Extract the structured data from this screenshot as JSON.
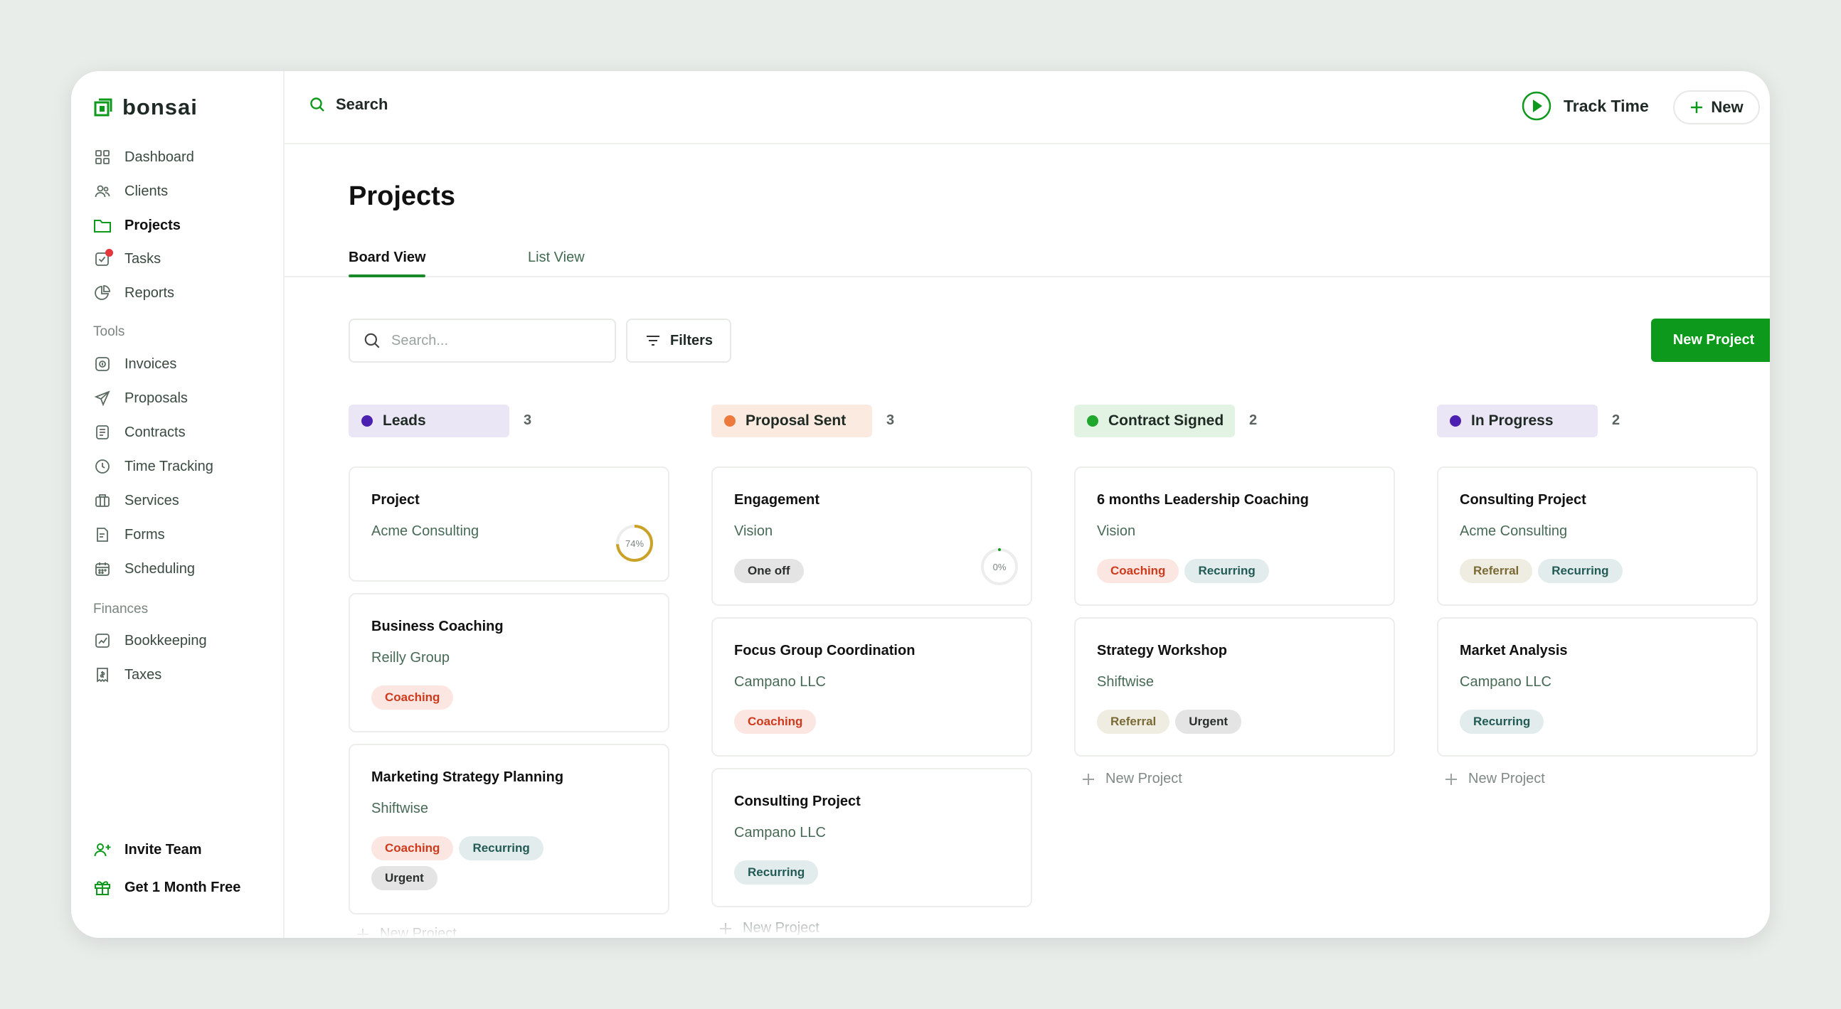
{
  "app": {
    "name": "bonsai"
  },
  "sidebar": {
    "items": [
      {
        "label": "Dashboard",
        "icon": "grid-icon"
      },
      {
        "label": "Clients",
        "icon": "users-icon"
      },
      {
        "label": "Projects",
        "icon": "folder-icon",
        "active": true
      },
      {
        "label": "Tasks",
        "icon": "task-check-icon",
        "badge": true
      },
      {
        "label": "Reports",
        "icon": "pie-chart-icon"
      }
    ],
    "tools_label": "Tools",
    "tools": [
      {
        "label": "Invoices",
        "icon": "invoice-icon"
      },
      {
        "label": "Proposals",
        "icon": "send-icon"
      },
      {
        "label": "Contracts",
        "icon": "document-icon"
      },
      {
        "label": "Time Tracking",
        "icon": "clock-icon"
      },
      {
        "label": "Services",
        "icon": "briefcase-icon"
      },
      {
        "label": "Forms",
        "icon": "form-icon"
      },
      {
        "label": "Scheduling",
        "icon": "calendar-icon"
      }
    ],
    "finances_label": "Finances",
    "finances": [
      {
        "label": "Bookkeeping",
        "icon": "chart-line-icon"
      },
      {
        "label": "Taxes",
        "icon": "tax-icon"
      }
    ],
    "invite_team": "Invite Team",
    "get_free": "Get 1 Month Free"
  },
  "topbar": {
    "search_label": "Search",
    "track_time": "Track Time",
    "new_label": "New"
  },
  "page": {
    "title": "Projects",
    "tabs": [
      {
        "label": "Board View",
        "active": true
      },
      {
        "label": "List View",
        "active": false
      }
    ],
    "search_placeholder": "Search...",
    "filters_label": "Filters",
    "new_project_label": "New Project",
    "add_project_label": "New Project"
  },
  "colors": {
    "accent": "#0d9a1c",
    "leads_dot": "#4b1fb0",
    "leads_bg": "#ebe6f6",
    "proposal_dot": "#ec7a3c",
    "proposal_bg": "#fbeae0",
    "contract_dot": "#1ea62d",
    "contract_bg": "#e2f3e3",
    "progress_dot": "#4b1fb0",
    "progress_bg": "#ebe6f6"
  },
  "columns": [
    {
      "name": "Leads",
      "count": "3",
      "cards": [
        {
          "title": "Project",
          "client": "Acme Consulting",
          "progress": "74%",
          "progress_value": 0.74
        },
        {
          "title": "Business Coaching",
          "client": "Reilly Group",
          "tags": [
            "Coaching"
          ]
        },
        {
          "title": "Marketing Strategy Planning",
          "client": "Shiftwise",
          "tags": [
            "Coaching",
            "Recurring",
            "Urgent"
          ]
        }
      ]
    },
    {
      "name": "Proposal Sent",
      "count": "3",
      "cards": [
        {
          "title": "Engagement",
          "client": "Vision",
          "tags": [
            "One off"
          ],
          "progress": "0%",
          "progress_value": 0.0
        },
        {
          "title": "Focus Group Coordination",
          "client": "Campano LLC",
          "tags": [
            "Coaching"
          ]
        },
        {
          "title": "Consulting Project",
          "client": "Campano LLC",
          "tags": [
            "Recurring"
          ]
        }
      ]
    },
    {
      "name": "Contract Signed",
      "count": "2",
      "cards": [
        {
          "title": "6 months Leadership Coaching",
          "client": "Vision",
          "tags": [
            "Coaching",
            "Recurring"
          ]
        },
        {
          "title": "Strategy Workshop",
          "client": "Shiftwise",
          "tags": [
            "Referral",
            "Urgent"
          ]
        }
      ]
    },
    {
      "name": "In Progress",
      "count": "2",
      "cards": [
        {
          "title": "Consulting Project",
          "client": "Acme Consulting",
          "tags": [
            "Referral",
            "Recurring"
          ]
        },
        {
          "title": "Market Analysis",
          "client": "Campano LLC",
          "tags": [
            "Recurring"
          ]
        }
      ]
    }
  ],
  "help_label": "?"
}
